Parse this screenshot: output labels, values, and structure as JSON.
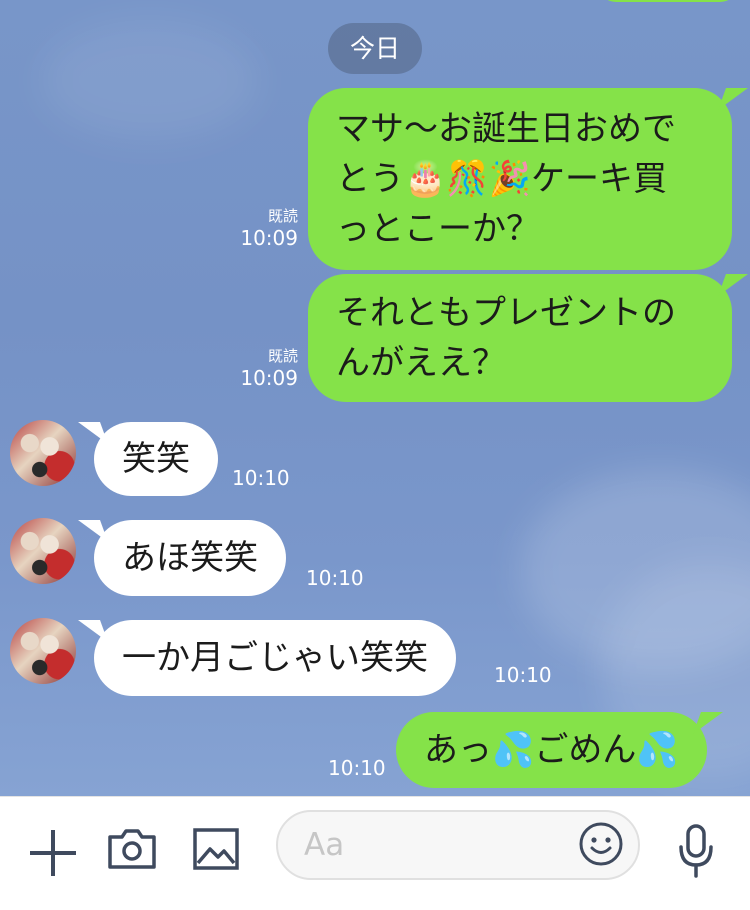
{
  "date_divider": "今日",
  "messages": [
    {
      "direction": "outgoing",
      "lines": [
        "マサ〜お誕生日おめで",
        "とう🎂🎊🎉ケーキ買",
        "っとこーか？"
      ],
      "read_label": "既読",
      "time": "10:09"
    },
    {
      "direction": "outgoing",
      "lines": [
        "それともプレゼントの",
        "んがええ？"
      ],
      "read_label": "既読",
      "time": "10:09"
    },
    {
      "direction": "incoming",
      "text": "笑笑",
      "time": "10:10"
    },
    {
      "direction": "incoming",
      "text": "あほ笑笑",
      "time": "10:10"
    },
    {
      "direction": "incoming",
      "text": "一か月ごじゃい笑笑",
      "time": "10:10"
    },
    {
      "direction": "outgoing",
      "text": "あっ💦ごめん💦",
      "time": "10:10"
    }
  ],
  "input_bar": {
    "placeholder": "Aa",
    "icons": [
      "plus-icon",
      "camera-icon",
      "image-icon",
      "smile-icon",
      "microphone-icon"
    ]
  },
  "colors": {
    "chat_background": "#7896c9",
    "outgoing_bubble": "#85e249",
    "incoming_bubble": "#ffffff",
    "icon": "#3f4a5e"
  }
}
